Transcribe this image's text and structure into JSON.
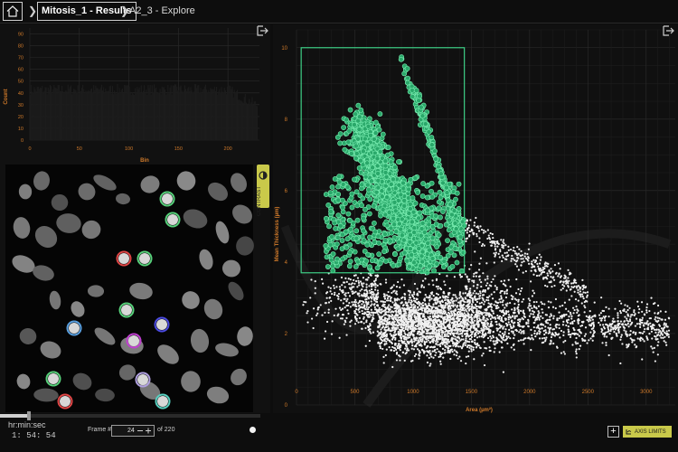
{
  "header": {
    "breadcrumb_active": "Mitosis_1 - Results",
    "breadcrumb_current": "A2_3 - Explore"
  },
  "histogram": {
    "ylabel": "Count",
    "xlabel": "Bin",
    "yticks": [
      "0",
      "10",
      "20",
      "30",
      "40",
      "50",
      "60",
      "70",
      "80",
      "90"
    ],
    "xticks": [
      "0",
      "50",
      "100",
      "150",
      "200"
    ]
  },
  "image_viewer": {
    "contrast_label": "CONTRAST"
  },
  "scatter": {
    "xlabel": "Area (µm²)",
    "ylabel": "Mean Thickness (µm)",
    "xticks": [
      "0",
      "500",
      "1000",
      "1500",
      "2000",
      "2500",
      "3000"
    ],
    "yticks": [
      "0",
      "2",
      "4",
      "6",
      "8",
      "10"
    ],
    "axis_limits_label": "AXIS LIMITS",
    "add_label": "+"
  },
  "footer": {
    "hms_label": "hr:min:sec",
    "hms_value": "1: 54: 54",
    "frame_label": "Frame #",
    "frame_value": "24",
    "frame_total": "of 220",
    "progress": 0.11
  },
  "colors": {
    "accent": "#c9c94a",
    "gate": "#3ecf86",
    "axis_text": "#d07a2a"
  },
  "chart_data": {
    "type": "scatter",
    "xlabel": "Area (µm²)",
    "ylabel": "Mean Thickness (µm)",
    "xlim": [
      0,
      3250
    ],
    "ylim": [
      0,
      10.5
    ],
    "grid": true,
    "gate": {
      "x": [
        40,
        1440
      ],
      "y": [
        3.7,
        10
      ]
    },
    "series": [
      {
        "color": "#3ecf86",
        "values": "points inside gate (~2000)"
      },
      {
        "color": "#ffffff",
        "values": "points outside gate (~5000)"
      }
    ]
  }
}
